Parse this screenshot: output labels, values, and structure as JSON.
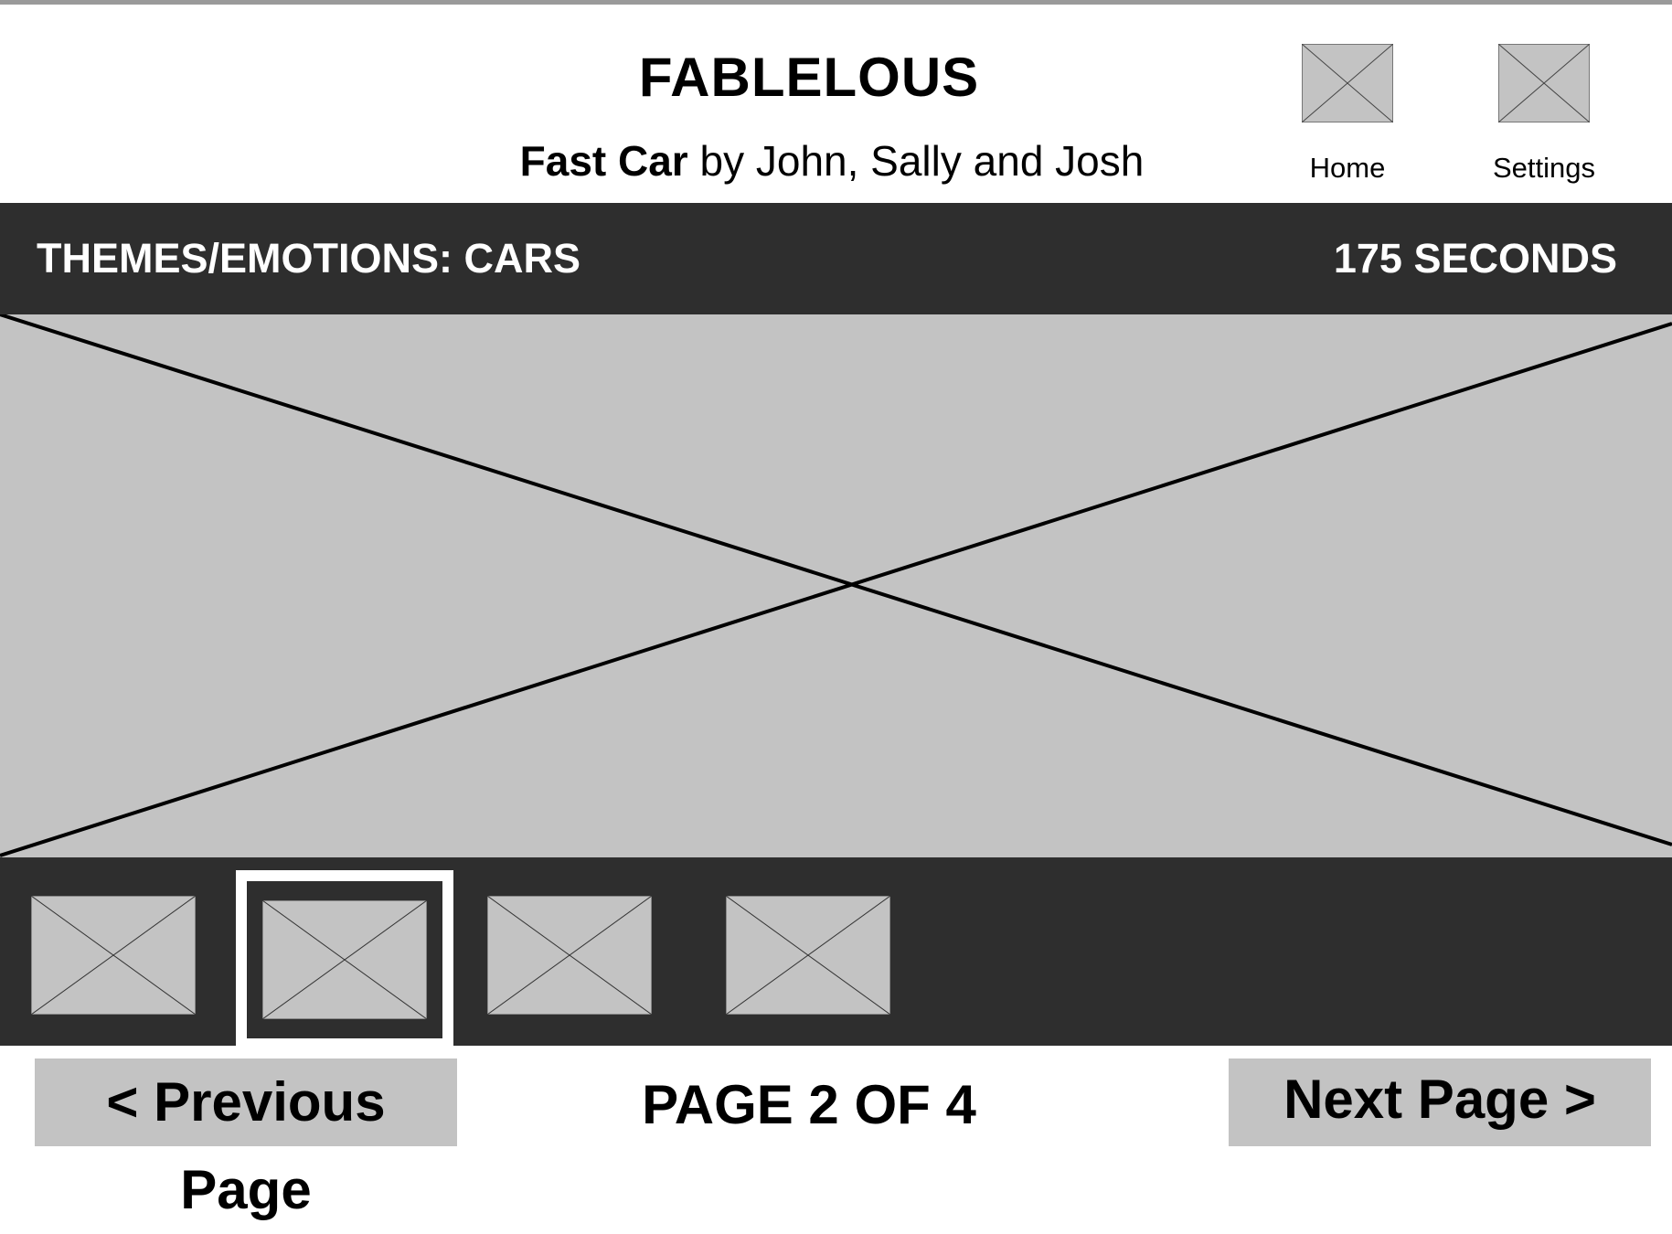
{
  "header": {
    "app_title": "FABLELOUS",
    "story_title": "Fast Car",
    "story_byline": " by John, Sally and Josh"
  },
  "nav": {
    "home_label": "Home",
    "settings_label": "Settings",
    "home_icon": "image-placeholder-icon",
    "settings_icon": "image-placeholder-icon"
  },
  "info_bar": {
    "theme_label": "THEMES/EMOTIONS: CARS",
    "timer_label": "175 SECONDS"
  },
  "thumbnails": {
    "count": 4,
    "selected_index": 1
  },
  "footer": {
    "prev_label": "< Previous Page",
    "next_label": "Next Page >",
    "page_indicator": "PAGE 2 OF 4"
  },
  "colors": {
    "dark_bar": "#2e2e2e",
    "placeholder_fill": "#c3c3c3",
    "button_fill": "#c3c3c3"
  }
}
